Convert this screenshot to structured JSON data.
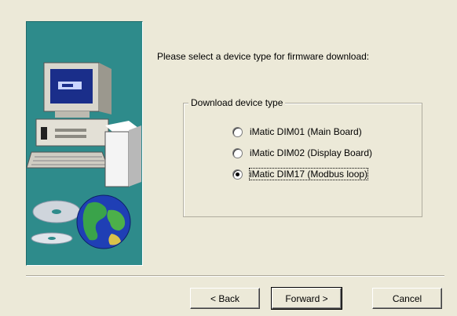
{
  "wizard": {
    "prompt": "Please select a device type for firmware download:",
    "group_title": "Download device type",
    "options": [
      {
        "label": "iMatic DIM01 (Main Board)",
        "checked": false
      },
      {
        "label": "iMatic DIM02 (Display Board)",
        "checked": false
      },
      {
        "label": "iMatic DIM17 (Modbus loop)",
        "checked": true
      }
    ],
    "image_icons": [
      "computer-icon",
      "cd-disc-icon",
      "globe-icon"
    ]
  },
  "buttons": {
    "back": "< Back",
    "forward": "Forward >",
    "cancel": "Cancel"
  },
  "colors": {
    "dialog_bg": "#ece9d8",
    "image_bg": "#2e8b8b"
  }
}
